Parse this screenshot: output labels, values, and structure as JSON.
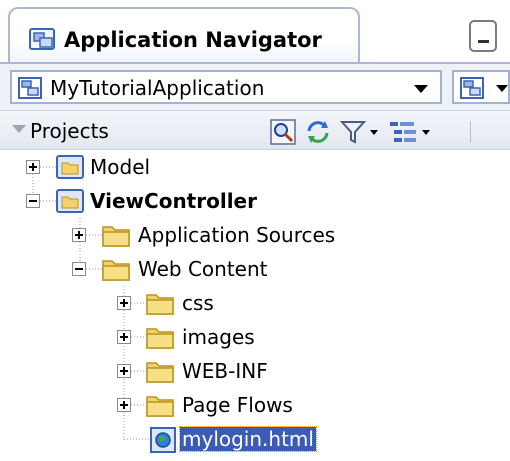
{
  "window": {
    "tab_title": "Application Navigator",
    "tab_icon": "application-navigator-icon",
    "minimize_icon": "minimize-icon"
  },
  "app_selector": {
    "value": "MyTutorialApplication",
    "icon": "application-icon",
    "menu_icon": "application-menu-icon"
  },
  "projects_panel": {
    "label": "Projects",
    "toolbar": [
      "search-icon",
      "refresh-icon",
      "filter-icon",
      "options-icon"
    ]
  },
  "tree": [
    {
      "label": "Model",
      "state": "collapsed",
      "icon": "project-folder-icon"
    },
    {
      "label": "ViewController",
      "state": "expanded",
      "icon": "project-folder-icon"
    },
    {
      "label": "Application Sources",
      "state": "collapsed",
      "icon": "folder-icon"
    },
    {
      "label": "Web Content",
      "state": "expanded",
      "icon": "folder-icon"
    },
    {
      "label": "css",
      "state": "collapsed",
      "icon": "folder-icon"
    },
    {
      "label": "images",
      "state": "collapsed",
      "icon": "folder-icon"
    },
    {
      "label": "WEB-INF",
      "state": "collapsed",
      "icon": "folder-icon"
    },
    {
      "label": "Page Flows",
      "state": "collapsed",
      "icon": "folder-icon"
    },
    {
      "label": "mylogin.html",
      "state": "leaf",
      "icon": "html-file-icon",
      "selected": true
    }
  ],
  "colors": {
    "selection": "#3b5bb5",
    "panel_border": "#a9b9d4",
    "folder": "#f2d36b"
  }
}
